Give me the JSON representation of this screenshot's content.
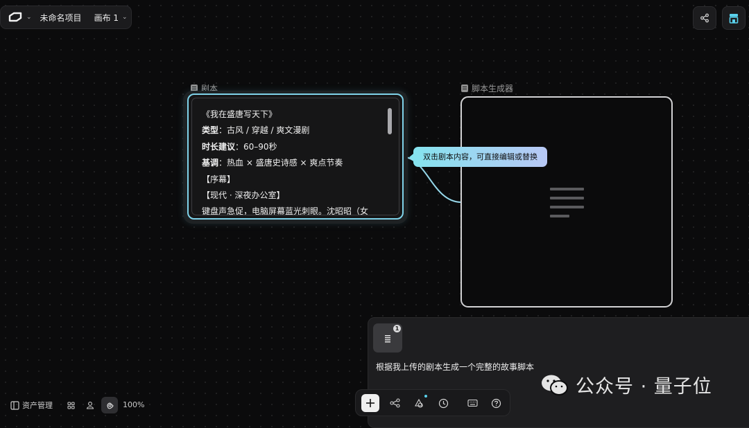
{
  "topbar": {
    "project_name": "未命名项目",
    "canvas_label": "画布 1"
  },
  "script_node": {
    "label": "剧本",
    "lines": [
      {
        "key": "",
        "text": "《我在盛唐写天下》"
      },
      {
        "key": "类型",
        "text": "：古风 / 穿越 / 爽文漫剧"
      },
      {
        "key": "时长建议",
        "text": "：60–90秒"
      },
      {
        "key": "基调",
        "text": "：热血 × 盛唐史诗感 × 爽点节奏"
      },
      {
        "key": "",
        "text": "【序幕】"
      },
      {
        "key": "",
        "text": "【现代 · 深夜办公室】"
      },
      {
        "key": "",
        "text": "键盘声急促，电脑屏幕蓝光刺眼。沈昭昭（女"
      }
    ]
  },
  "generator_node": {
    "label": "脚本生成器"
  },
  "tooltip": {
    "text": "双击剧本内容，可直接编辑或替换"
  },
  "chat": {
    "attachment_count": "1",
    "prompt": "根据我上传的剧本生成一个完整的故事脚本"
  },
  "watermark": {
    "text": "公众号 · 量子位"
  },
  "bottom_left": {
    "assets_label": "资产管理",
    "zoom": "100%"
  },
  "icons": {
    "logo": "app-logo-icon",
    "share": "share-icon",
    "store": "store-icon",
    "document": "document-icon",
    "panel": "sidebar-panel-icon",
    "grid": "grid-icon",
    "person": "person-icon",
    "hand": "pan-hand-icon",
    "add": "plus-icon",
    "workflow": "workflow-icon",
    "shapes": "shapes-icon",
    "history": "clock-icon",
    "keyboard": "keyboard-icon",
    "help": "help-icon"
  },
  "colors": {
    "accent": "#7fd3ea",
    "tooltip_start": "#85e3ee",
    "tooltip_end": "#b8c8f5",
    "store_icon": "#5ad1ec"
  }
}
